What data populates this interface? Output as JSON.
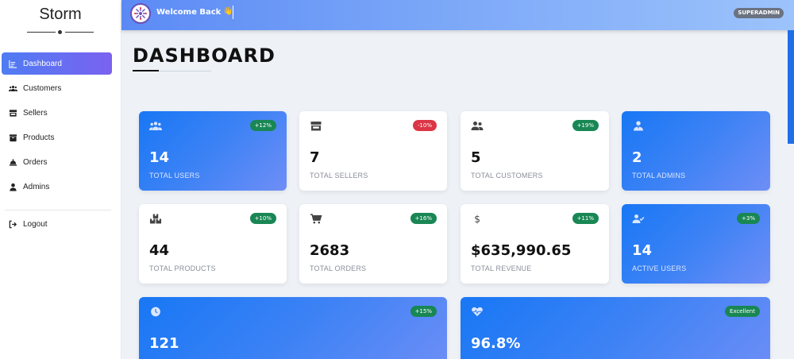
{
  "sidebar": {
    "brand": "Storm",
    "items": [
      {
        "label": "Dashboard",
        "icon": "dashboard-icon",
        "active": true
      },
      {
        "label": "Customers",
        "icon": "users-icon"
      },
      {
        "label": "Sellers",
        "icon": "store-icon"
      },
      {
        "label": "Products",
        "icon": "box-icon"
      },
      {
        "label": "Orders",
        "icon": "bell-icon"
      },
      {
        "label": "Admins",
        "icon": "user-icon"
      }
    ],
    "logout": "Logout"
  },
  "header": {
    "welcome": "Welcome Back",
    "emoji": "👋",
    "role": "SUPERADMIN"
  },
  "main": {
    "title": "DASHBOARD",
    "cards": [
      {
        "value": "14",
        "label": "TOTAL USERS",
        "badge": "+12%",
        "badge_type": "green",
        "style": "blue",
        "icon": "users-icon"
      },
      {
        "value": "7",
        "label": "TOTAL SELLERS",
        "badge": "-10%",
        "badge_type": "red",
        "style": "white",
        "icon": "store-icon"
      },
      {
        "value": "5",
        "label": "TOTAL CUSTOMERS",
        "badge": "+19%",
        "badge_type": "green",
        "style": "white",
        "icon": "customers-icon"
      },
      {
        "value": "2",
        "label": "TOTAL ADMINS",
        "badge": "",
        "badge_type": "",
        "style": "blue",
        "icon": "admin-icon"
      },
      {
        "value": "44",
        "label": "TOTAL PRODUCTS",
        "badge": "+10%",
        "badge_type": "green",
        "style": "white",
        "icon": "boxes-icon"
      },
      {
        "value": "2683",
        "label": "TOTAL ORDERS",
        "badge": "+16%",
        "badge_type": "green",
        "style": "white",
        "icon": "cart-icon"
      },
      {
        "value": "$635,990.65",
        "label": "TOTAL REVENUE",
        "badge": "+11%",
        "badge_type": "green",
        "style": "white",
        "icon": "dollar-icon"
      },
      {
        "value": "14",
        "label": "ACTIVE USERS",
        "badge": "+3%",
        "badge_type": "green",
        "style": "blue",
        "icon": "user-check-icon"
      },
      {
        "value": "121",
        "label": "",
        "badge": "+15%",
        "badge_type": "green",
        "style": "blue",
        "icon": "clock-icon"
      },
      {
        "value": "96.8%",
        "label": "",
        "badge": "Excellent",
        "badge_type": "green",
        "style": "blue",
        "icon": "heartbeat-icon"
      }
    ]
  },
  "colors": {
    "accent": "#1877f5",
    "active_nav_start": "#4f7cf3",
    "active_nav_end": "#7a62f0",
    "badge_green": "#198754",
    "badge_red": "#dc3545"
  }
}
